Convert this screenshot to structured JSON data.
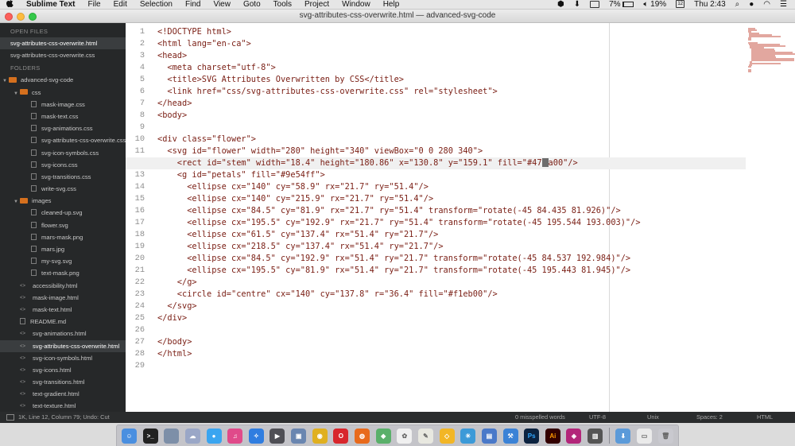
{
  "menubar": {
    "app_name": "Sublime Text",
    "menus": [
      "File",
      "Edit",
      "Selection",
      "Find",
      "View",
      "Goto",
      "Tools",
      "Project",
      "Window",
      "Help"
    ],
    "battery": "7%",
    "volume": "19%",
    "date_badge": "12",
    "clock": "Thu 2:43"
  },
  "window": {
    "title": "svg-attributes-css-overwrite.html — advanced-svg-code"
  },
  "sidebar": {
    "open_files_heading": "OPEN FILES",
    "open_files": [
      {
        "name": "svg-attributes-css-overwrite.html",
        "selected": true
      },
      {
        "name": "svg-attributes-css-overwrite.css",
        "selected": false
      }
    ],
    "folders_heading": "FOLDERS",
    "tree": [
      {
        "name": "advanced-svg-code",
        "depth": 0,
        "type": "folder",
        "open": true
      },
      {
        "name": "css",
        "depth": 1,
        "type": "folder",
        "open": true
      },
      {
        "name": "mask-image.css",
        "depth": 2,
        "type": "file"
      },
      {
        "name": "mask-text.css",
        "depth": 2,
        "type": "file"
      },
      {
        "name": "svg-animations.css",
        "depth": 2,
        "type": "file"
      },
      {
        "name": "svg-attributes-css-overwrite.css",
        "depth": 2,
        "type": "file"
      },
      {
        "name": "svg-icon-symbols.css",
        "depth": 2,
        "type": "file"
      },
      {
        "name": "svg-icons.css",
        "depth": 2,
        "type": "file"
      },
      {
        "name": "svg-transitions.css",
        "depth": 2,
        "type": "file"
      },
      {
        "name": "write-svg.css",
        "depth": 2,
        "type": "file"
      },
      {
        "name": "images",
        "depth": 1,
        "type": "folder",
        "open": true
      },
      {
        "name": "cleaned-up.svg",
        "depth": 2,
        "type": "file"
      },
      {
        "name": "flower.svg",
        "depth": 2,
        "type": "file"
      },
      {
        "name": "mars-mask.png",
        "depth": 2,
        "type": "file"
      },
      {
        "name": "mars.jpg",
        "depth": 2,
        "type": "file"
      },
      {
        "name": "my-svg.svg",
        "depth": 2,
        "type": "file"
      },
      {
        "name": "text-mask.png",
        "depth": 2,
        "type": "file"
      },
      {
        "name": "accessibility.html",
        "depth": 1,
        "type": "code"
      },
      {
        "name": "mask-image.html",
        "depth": 1,
        "type": "code"
      },
      {
        "name": "mask-text.html",
        "depth": 1,
        "type": "code"
      },
      {
        "name": "README.md",
        "depth": 1,
        "type": "file"
      },
      {
        "name": "svg-animations.html",
        "depth": 1,
        "type": "code"
      },
      {
        "name": "svg-attributes-css-overwrite.html",
        "depth": 1,
        "type": "code",
        "selected": true
      },
      {
        "name": "svg-icon-symbols.html",
        "depth": 1,
        "type": "code"
      },
      {
        "name": "svg-icons.html",
        "depth": 1,
        "type": "code"
      },
      {
        "name": "svg-transitions.html",
        "depth": 1,
        "type": "code"
      },
      {
        "name": "text-gradient.html",
        "depth": 1,
        "type": "code"
      },
      {
        "name": "text-texture.html",
        "depth": 1,
        "type": "code"
      }
    ]
  },
  "editor": {
    "current_line": 12,
    "gutter_mark": "⇐",
    "lines": [
      "<!DOCTYPE html>",
      "<html lang=\"en-ca\">",
      "<head>",
      "  <meta charset=\"utf-8\">",
      "  <title>SVG Attributes Overwritten by CSS</title>",
      "  <link href=\"css/svg-attributes-css-overwrite.css\" rel=\"stylesheet\">",
      "</head>",
      "<body>",
      "",
      "<div class=\"flower\">",
      "  <svg id=\"flower\" width=\"280\" height=\"340\" viewBox=\"0 0 280 340\">",
      "    <rect id=\"stem\" width=\"18.4\" height=\"180.86\" x=\"130.8\" y=\"159.1\" fill=\"#47",
      "    <g id=\"petals\" fill=\"#9e54ff\">",
      "      <ellipse cx=\"140\" cy=\"58.9\" rx=\"21.7\" ry=\"51.4\"/>",
      "      <ellipse cx=\"140\" cy=\"215.9\" rx=\"21.7\" ry=\"51.4\"/>",
      "      <ellipse cx=\"84.5\" cy=\"81.9\" rx=\"21.7\" ry=\"51.4\" transform=\"rotate(-45 84.435 81.926)\"/>",
      "      <ellipse cx=\"195.5\" cy=\"192.9\" rx=\"21.7\" ry=\"51.4\" transform=\"rotate(-45 195.544 193.003)\"/>",
      "      <ellipse cx=\"61.5\" cy=\"137.4\" rx=\"51.4\" ry=\"21.7\"/>",
      "      <ellipse cx=\"218.5\" cy=\"137.4\" rx=\"51.4\" ry=\"21.7\"/>",
      "      <ellipse cx=\"84.5\" cy=\"192.9\" rx=\"51.4\" ry=\"21.7\" transform=\"rotate(-45 84.537 192.984)\"/>",
      "      <ellipse cx=\"195.5\" cy=\"81.9\" rx=\"51.4\" ry=\"21.7\" transform=\"rotate(-45 195.443 81.945)\"/>",
      "    </g>",
      "    <circle id=\"centre\" cx=\"140\" cy=\"137.8\" r=\"36.4\" fill=\"#f1eb00\"/>",
      "  </svg>",
      "</div>",
      "",
      "</body>",
      "</html>",
      ""
    ],
    "line12_after_cursor": "a00\"/>"
  },
  "statusbar": {
    "position": "1K, Line 12, Column 79; Undo: Cut",
    "spelling": "0 misspelled words",
    "encoding": "UTF-8",
    "line_endings": "Unix",
    "indentation": "Spaces: 2",
    "syntax": "HTML"
  },
  "dock": {
    "apps": [
      "finder-icon",
      "terminal-icon",
      "files-icon",
      "cloud-icon",
      "messages-icon",
      "itunes-icon",
      "safari-icon",
      "quicktime-icon",
      "preview-icon",
      "chrome-icon",
      "opera-icon",
      "firefox-icon",
      "maps-icon",
      "photos-icon",
      "textedit-icon",
      "sketch-icon",
      "mindnode-icon",
      "keynote-icon",
      "xcode-icon",
      "photoshop-icon",
      "illustrator-icon",
      "affinity-icon",
      "monitor-icon"
    ],
    "stacks": [
      "downloads-stack-icon",
      "desktop-stack-icon",
      "trash-icon"
    ]
  }
}
